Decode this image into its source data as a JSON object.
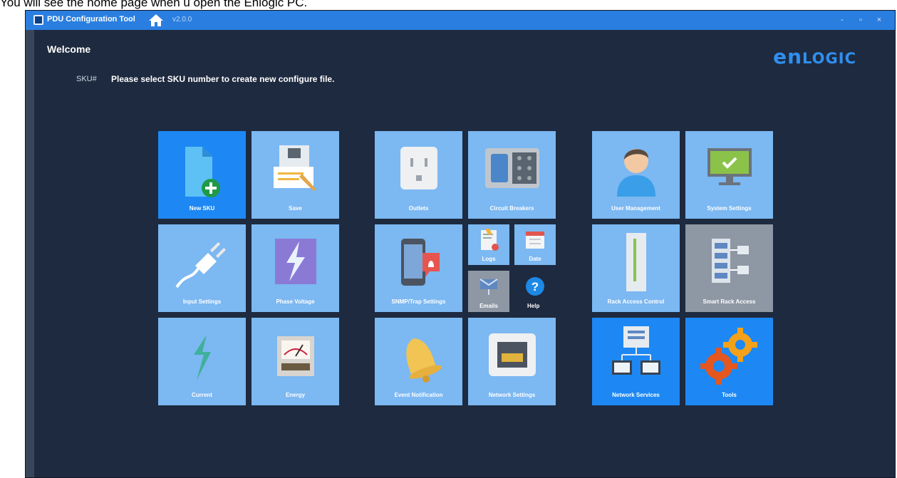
{
  "caption": "You will see the home page when u open the Enlogic PC.",
  "window": {
    "title": "PDU Configuration Tool",
    "version": "v2.0.0",
    "controls": {
      "minimize": "-",
      "maximize": "▫",
      "close": "×"
    }
  },
  "welcome": "Welcome",
  "sku": {
    "label": "SKU#",
    "message": "Please select SKU number to create new configure file."
  },
  "brand": {
    "big": "en",
    "small": "LOGIC",
    "color": "#2f8ff0"
  },
  "colors": {
    "titlebar": "#2a7ee0",
    "background": "#1e2a3f",
    "tile_light": "#7cb8f2",
    "tile_blue": "#1d88f3",
    "tile_gray": "#8e97a4"
  },
  "tiles": {
    "new_sku": {
      "label": "New SKU",
      "icon": "new-file-icon"
    },
    "save": {
      "label": "Save",
      "icon": "save-icon"
    },
    "input_settings": {
      "label": "Input Settings",
      "icon": "plug-icon"
    },
    "phase_voltage": {
      "label": "Phase Voltage",
      "icon": "lightning-icon"
    },
    "current": {
      "label": "Current",
      "icon": "current-icon"
    },
    "energy": {
      "label": "Energy",
      "icon": "meter-icon"
    },
    "outlets": {
      "label": "Outlets",
      "icon": "outlet-icon"
    },
    "circuit_breakers": {
      "label": "Circuit Breakers",
      "icon": "breaker-icon"
    },
    "snmp_trap": {
      "label": "SNMP/Trap Settings",
      "icon": "phone-alert-icon"
    },
    "logs": {
      "label": "Logs",
      "icon": "logs-icon"
    },
    "date": {
      "label": "Date",
      "icon": "calendar-icon"
    },
    "emails": {
      "label": "Emails",
      "icon": "email-icon"
    },
    "help": {
      "label": "Help",
      "icon": "help-icon"
    },
    "event_notification": {
      "label": "Event Notification",
      "icon": "bell-icon"
    },
    "network_settings": {
      "label": "Network Settings",
      "icon": "ethernet-icon"
    },
    "user_management": {
      "label": "User Management",
      "icon": "user-icon"
    },
    "system_settings": {
      "label": "System Settings",
      "icon": "monitor-icon"
    },
    "rack_access_control": {
      "label": "Rack Access Control",
      "icon": "rack-icon"
    },
    "smart_rack_access": {
      "label": "Smart Rack Access",
      "icon": "server-rack-icon"
    },
    "network_services": {
      "label": "Network Services",
      "icon": "network-icon"
    },
    "tools": {
      "label": "Tools",
      "icon": "gears-icon"
    }
  }
}
